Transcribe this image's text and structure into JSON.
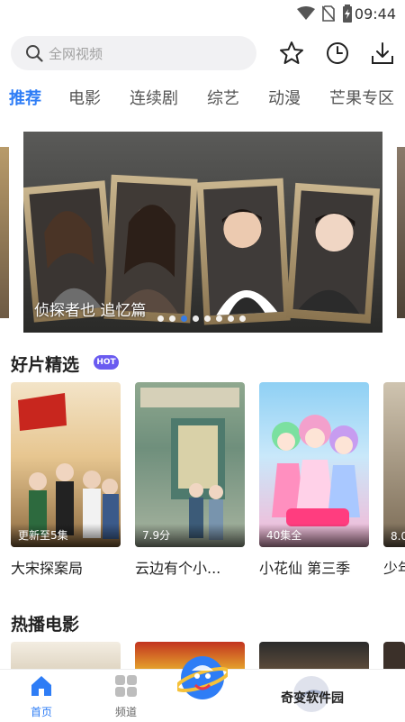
{
  "status_bar": {
    "time": "09:44",
    "icons": [
      "wifi-icon",
      "no-sim-icon",
      "battery-icon"
    ]
  },
  "search": {
    "placeholder": "全网视频"
  },
  "top_actions": [
    "star-icon",
    "history-clock-icon",
    "download-icon"
  ],
  "tabs": [
    {
      "label": "推荐",
      "active": true
    },
    {
      "label": "电影"
    },
    {
      "label": "连续剧"
    },
    {
      "label": "综艺"
    },
    {
      "label": "动漫"
    },
    {
      "label": "芒果专区"
    }
  ],
  "banner": {
    "title": "侦探者也 追忆篇",
    "slide_count": 8,
    "active_slide": 2
  },
  "featured": {
    "title": "好片精选",
    "badge": "HOT",
    "items": [
      {
        "title": "大宋探案局",
        "badge": "更新至5集"
      },
      {
        "title": "云边有个小...",
        "badge": "7.9分"
      },
      {
        "title": "小花仙 第三季",
        "badge": "40集全"
      },
      {
        "title": "少年",
        "badge": "8.0"
      }
    ]
  },
  "hot_movies": {
    "title": "热播电影"
  },
  "bottom_nav": [
    {
      "label": "首页",
      "active": true
    },
    {
      "label": "频道"
    }
  ],
  "watermark": {
    "text": "奇变软件园"
  },
  "colors": {
    "accent": "#2e7df6",
    "hot_badge": "#6a5bf0"
  }
}
